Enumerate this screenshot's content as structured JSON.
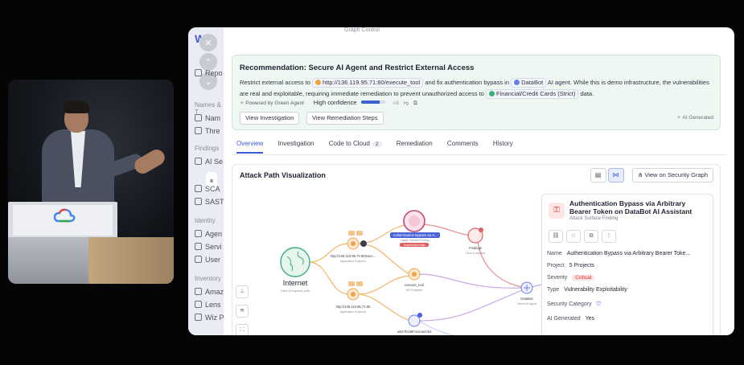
{
  "sidebar": {
    "items": [
      {
        "label": "Repo"
      },
      {
        "label": "Names & T"
      },
      {
        "label": "Nam"
      },
      {
        "label": "Thre"
      },
      {
        "label": "Findings"
      },
      {
        "label": "AI Se"
      },
      {
        "label": "SCA"
      },
      {
        "label": "SAST"
      },
      {
        "label": "Identity"
      },
      {
        "label": "Agen"
      },
      {
        "label": "Servi"
      },
      {
        "label": "User"
      },
      {
        "label": "Inventory"
      },
      {
        "label": "Amaz"
      },
      {
        "label": "Lens"
      },
      {
        "label": "Wiz P"
      }
    ]
  },
  "topcrumb": "Graph Control",
  "recommendation": {
    "title": "Recommendation: Secure AI Agent and Restrict External Access",
    "body_pre": "Restrict external access to",
    "endpoint": "http://136.119.95.71:80/execute_tool",
    "body_mid": "and fix authentication bypass in",
    "agent": "DataBot",
    "body_post": "AI agent. While this is demo infrastructure, the vulnerabilities are real and exploitable, requiring immediate remediation to prevent unauthorized access to",
    "data_asset": "Financial/Credit Cards (Strict)",
    "body_end": "data.",
    "powered_by": "Powered by Green Agent",
    "confidence": "High confidence",
    "confidence_level": 0.75,
    "btn_investigation": "View Investigation",
    "btn_remediation": "View Remediation Steps",
    "ai_generated": "AI Generated"
  },
  "tabs": [
    {
      "label": "Overview",
      "active": true
    },
    {
      "label": "Investigation"
    },
    {
      "label": "Code to Cloud",
      "count": "2"
    },
    {
      "label": "Remediation"
    },
    {
      "label": "Comments"
    },
    {
      "label": "History"
    }
  ],
  "viz": {
    "title": "Attack Path Visualization",
    "security_graph_btn": "View on Security Graph",
    "nodes": {
      "internet": "Internet",
      "internet_sub": "Click to expand path",
      "ep1": "http://136.119.95.71:80/exec...",
      "ep1_sub": "Application Endpoint",
      "ep2": "http://136.119.95.71:80",
      "ep2_sub": "Application Endpoint",
      "finding_hl": "Authentication Bypass via A...",
      "finding_hl_sub": "Attack Surface Finding",
      "finding_tag": "Unauthorized Data",
      "exec_tool": "execute_tool",
      "exec_sub": "API Endpoint",
      "findings": "Findings",
      "findings_sub": "Click to expand",
      "databot": "DataBot",
      "databot_sub": "Vertex AI Agent",
      "bottom": "ai03-f0169f-scenario02"
    }
  },
  "card": {
    "title": "Authentication Bypass via Arbitrary Bearer Token on DataBot AI Assistant",
    "subtitle": "Attack Surface Finding",
    "rows": {
      "name_k": "Name",
      "name_v": "Authentication Bypass via Arbitrary Bearer Toke...",
      "project_k": "Project",
      "project_v": "5 Projects",
      "severity_k": "Severity",
      "severity_v": "Critical",
      "type_k": "Type",
      "type_v": "Vulnerability Exploitability",
      "security_k": "Security Category",
      "aigen_k": "AI Generated",
      "aigen_v": "Yes"
    }
  },
  "colors": {
    "accent": "#3b5bd6",
    "rec_bg": "#eef7f1",
    "critical": "#d0312d",
    "node_orange": "#f0a347",
    "node_green": "#3fae7a"
  }
}
